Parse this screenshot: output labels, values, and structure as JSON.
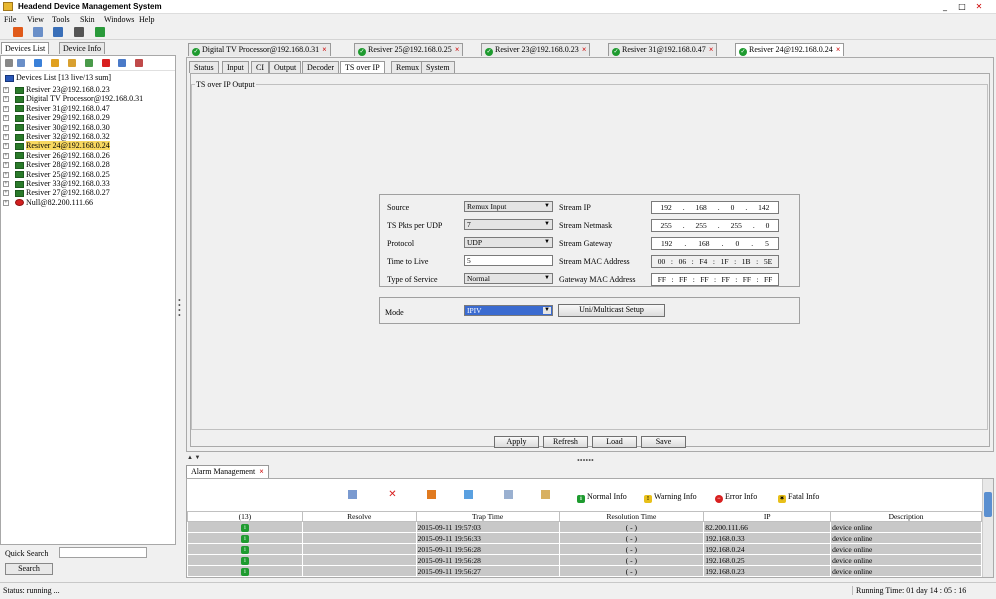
{
  "window": {
    "title": "Headend Device Management System",
    "minimize": "_",
    "restore": "□",
    "close": "✕"
  },
  "menu": [
    "File",
    "View",
    "Tools",
    "Skin",
    "Windows",
    "Help"
  ],
  "left_tabs": [
    "Devices List",
    "Device Info"
  ],
  "tree": {
    "root": "Devices List [13 live/13 sum]",
    "items": [
      {
        "label": "Resiver 23@192.168.0.23",
        "status": "online"
      },
      {
        "label": "Digital TV Processor@192.168.0.31",
        "status": "online"
      },
      {
        "label": "Resiver 31@192.168.0.47",
        "status": "online"
      },
      {
        "label": "Resiver 29@192.168.0.29",
        "status": "online"
      },
      {
        "label": "Resiver 30@192.168.0.30",
        "status": "online"
      },
      {
        "label": "Resiver 32@192.168.0.32",
        "status": "online"
      },
      {
        "label": "Resiver 24@192.168.0.24",
        "status": "online",
        "selected": true
      },
      {
        "label": "Resiver 26@192.168.0.26",
        "status": "online"
      },
      {
        "label": "Resiver 28@192.168.0.28",
        "status": "online"
      },
      {
        "label": "Resiver 25@192.168.0.25",
        "status": "online"
      },
      {
        "label": "Resiver 33@192.168.0.33",
        "status": "online"
      },
      {
        "label": "Resiver 27@192.168.0.27",
        "status": "online"
      },
      {
        "label": "Null@82.200.111.66",
        "status": "offline"
      }
    ]
  },
  "quick_search": {
    "label": "Quick Search",
    "value": "",
    "button": "Search"
  },
  "device_tabs": [
    "Digital TV Processor@192.168.0.31",
    "Resiver 25@192.168.0.25",
    "Resiver 23@192.168.0.23",
    "Resiver 31@192.168.0.47",
    "Resiver 24@192.168.0.24"
  ],
  "active_device_tab": 4,
  "sub_tabs": [
    "Status",
    "Input",
    "CI",
    "Output",
    "Decoder",
    "TS over IP",
    "Remux",
    "System"
  ],
  "active_sub_tab": 5,
  "group_title": "TS over IP Output",
  "form": {
    "source": {
      "label": "Source",
      "value": "Remux Input"
    },
    "pkts": {
      "label": "TS Pkts per UDP",
      "value": "7"
    },
    "protocol": {
      "label": "Protocol",
      "value": "UDP"
    },
    "ttl": {
      "label": "Time to Live",
      "value": "5"
    },
    "tos": {
      "label": "Type of Service",
      "value": "Normal"
    },
    "stream_ip": {
      "label": "Stream IP",
      "octets": [
        "192",
        "168",
        "0",
        "142"
      ]
    },
    "netmask": {
      "label": "Stream Netmask",
      "octets": [
        "255",
        "255",
        "255",
        "0"
      ]
    },
    "gateway": {
      "label": "Stream Gateway",
      "octets": [
        "192",
        "168",
        "0",
        "5"
      ]
    },
    "stream_mac": {
      "label": "Stream MAC Address",
      "octets": [
        "00",
        "06",
        "F4",
        "1F",
        "1B",
        "5E"
      ]
    },
    "gateway_mac": {
      "label": "Gateway MAC Address",
      "octets": [
        "FF",
        "FF",
        "FF",
        "FF",
        "FF",
        "FF"
      ]
    },
    "mode": {
      "label": "Mode",
      "value": "IPIV"
    },
    "multicast_button": "Uni/Multicast Setup"
  },
  "buttons": {
    "apply": "Apply",
    "refresh": "Refresh",
    "load": "Load",
    "save": "Save"
  },
  "splitter": "••••••",
  "alarm": {
    "tab": "Alarm Management",
    "legend": [
      {
        "label": "Normal Info",
        "color": "#1e9b2f",
        "glyph": "i"
      },
      {
        "label": "Warning Info",
        "color": "#e8c01a",
        "glyph": "!"
      },
      {
        "label": "Error Info",
        "color": "#d82020",
        "glyph": "−"
      },
      {
        "label": "Fatal Info",
        "color": "#2a2a2a",
        "glyph": "✶"
      }
    ],
    "columns": [
      "(13)",
      "Resolve",
      "Trap Time",
      "Resolution Time",
      "IP",
      "Description"
    ],
    "rows": [
      {
        "resolve": "",
        "trap_time": "2015-09-11 19:57:03",
        "resolution": "( - )",
        "ip": "82.200.111.66",
        "desc": "device online"
      },
      {
        "resolve": "",
        "trap_time": "2015-09-11 19:56:33",
        "resolution": "( - )",
        "ip": "192.168.0.33",
        "desc": "device online"
      },
      {
        "resolve": "",
        "trap_time": "2015-09-11 19:56:28",
        "resolution": "( - )",
        "ip": "192.168.0.24",
        "desc": "device online"
      },
      {
        "resolve": "",
        "trap_time": "2015-09-11 19:56:28",
        "resolution": "( - )",
        "ip": "192.168.0.25",
        "desc": "device online"
      },
      {
        "resolve": "",
        "trap_time": "2015-09-11 19:56:27",
        "resolution": "( - )",
        "ip": "192.168.0.23",
        "desc": "device online"
      }
    ]
  },
  "status": {
    "left": "Status: running ...",
    "right": "Running Time: 01 day 14 : 05 : 16"
  }
}
